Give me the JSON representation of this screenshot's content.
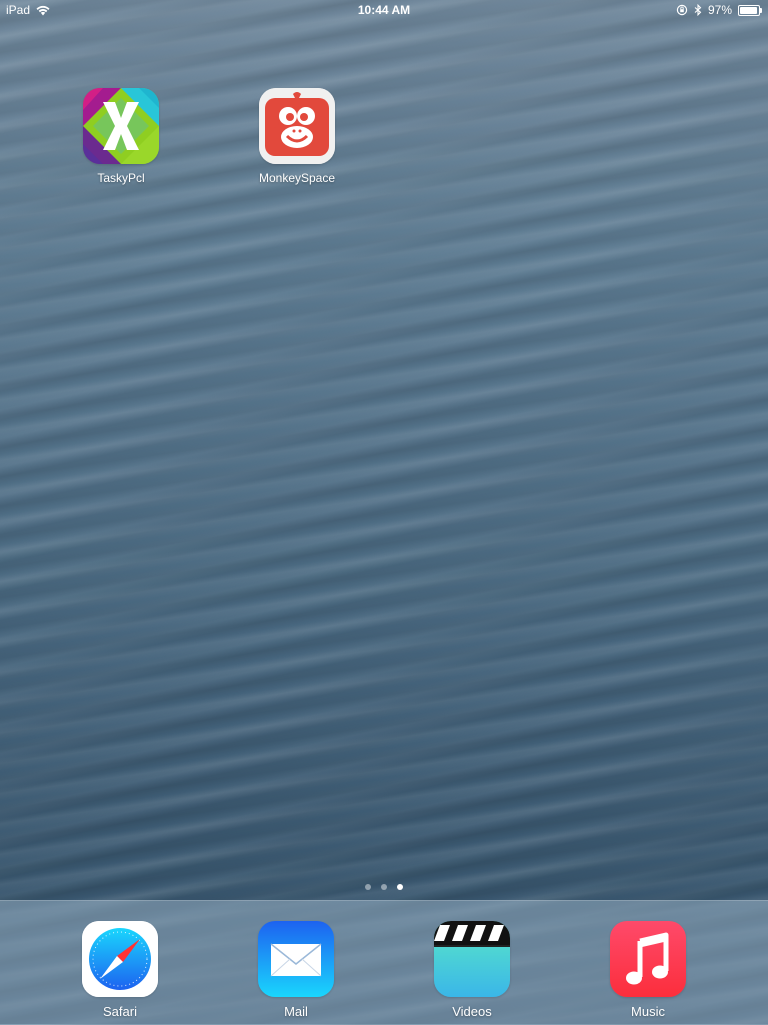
{
  "status_bar": {
    "device": "iPad",
    "time": "10:44 AM",
    "battery_percent": "97%",
    "battery_level": 0.97,
    "icons": [
      "wifi-icon",
      "orientation-lock-icon",
      "bluetooth-icon",
      "battery-icon"
    ]
  },
  "home_apps": [
    {
      "label": "TaskyPcl",
      "icon": "xamarin-x-icon"
    },
    {
      "label": "MonkeySpace",
      "icon": "monkey-icon"
    }
  ],
  "page_indicator": {
    "pages": 3,
    "current": 3
  },
  "dock_apps": [
    {
      "label": "Safari",
      "icon": "safari-compass-icon"
    },
    {
      "label": "Mail",
      "icon": "mail-envelope-icon"
    },
    {
      "label": "Videos",
      "icon": "video-clapper-icon"
    },
    {
      "label": "Music",
      "icon": "music-note-icon"
    }
  ],
  "colors": {
    "monkey_red": "#e2493c",
    "mail_blue": "#1d8cf8",
    "music_red": "#fc3158",
    "videos_teal": "#49d9c7"
  }
}
